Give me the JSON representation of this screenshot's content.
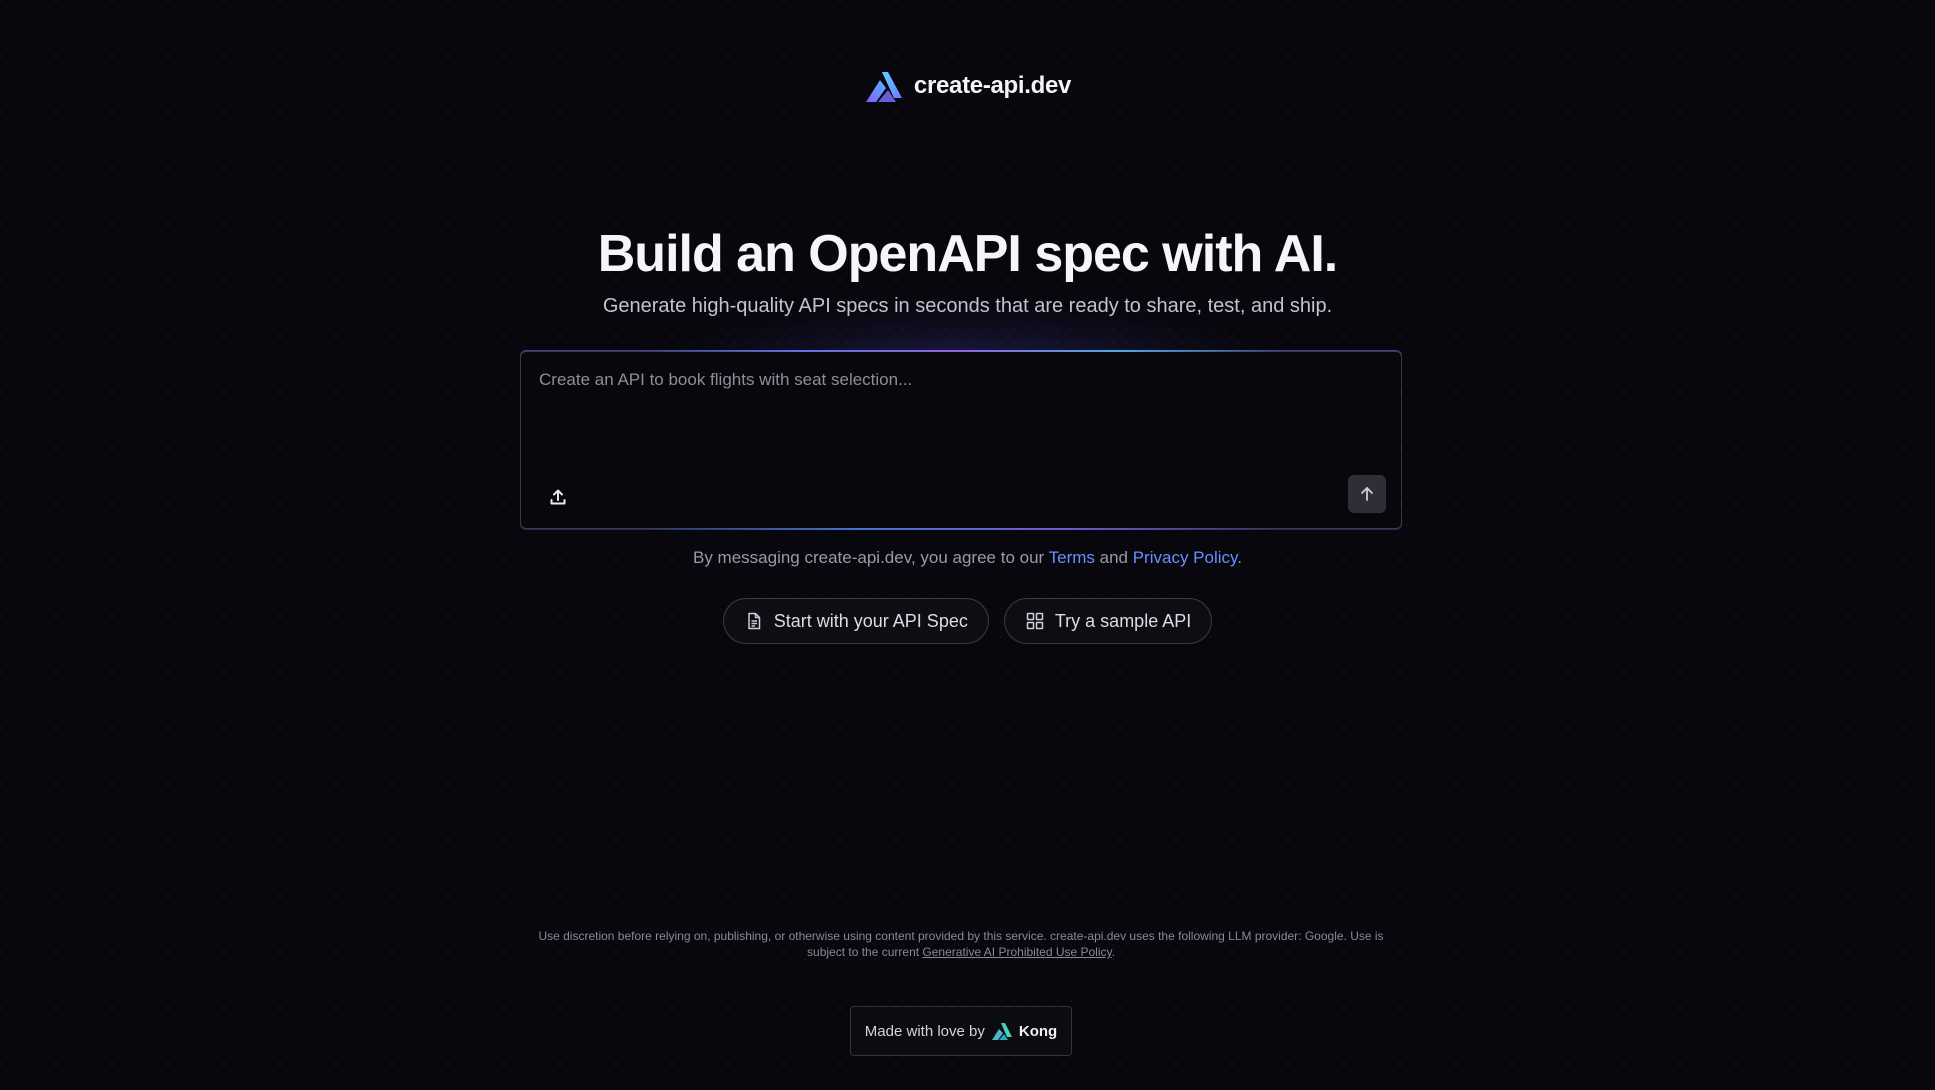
{
  "header": {
    "brand": "create-api.dev",
    "logo_icon": "create-api-logo-icon"
  },
  "hero": {
    "title": "Build an OpenAPI spec with AI.",
    "subtitle": "Generate high-quality API specs in seconds that are ready to share, test, and ship."
  },
  "prompt": {
    "value": "",
    "placeholder": "Create an API to book flights with seat selection...",
    "upload_icon": "upload-icon",
    "send_icon": "arrow-up-icon"
  },
  "agreement": {
    "prefix": "By messaging create-api.dev, you agree to our ",
    "terms_label": "Terms",
    "middle": " and ",
    "privacy_label": "Privacy Policy",
    "suffix": "."
  },
  "actions": {
    "start_spec_label": "Start with your API Spec",
    "start_spec_icon": "document-icon",
    "sample_label": "Try a sample API",
    "sample_icon": "grid-icon"
  },
  "footer": {
    "disclaimer_text": "Use discretion before relying on, publishing, or otherwise using content provided by this service. create-api.dev uses the following LLM provider: Google. Use is subject to the current ",
    "policy_link": "Generative AI Prohibited Use Policy",
    "disclaimer_end": ".",
    "made_with_label": "Made with love by",
    "kong_label": "Kong",
    "kong_icon": "kong-logo-icon"
  },
  "colors": {
    "background": "#07070d",
    "link": "#6d8cff",
    "accent_gradient": [
      "#6b7cff",
      "#a46bff",
      "#4fc3ff"
    ]
  }
}
